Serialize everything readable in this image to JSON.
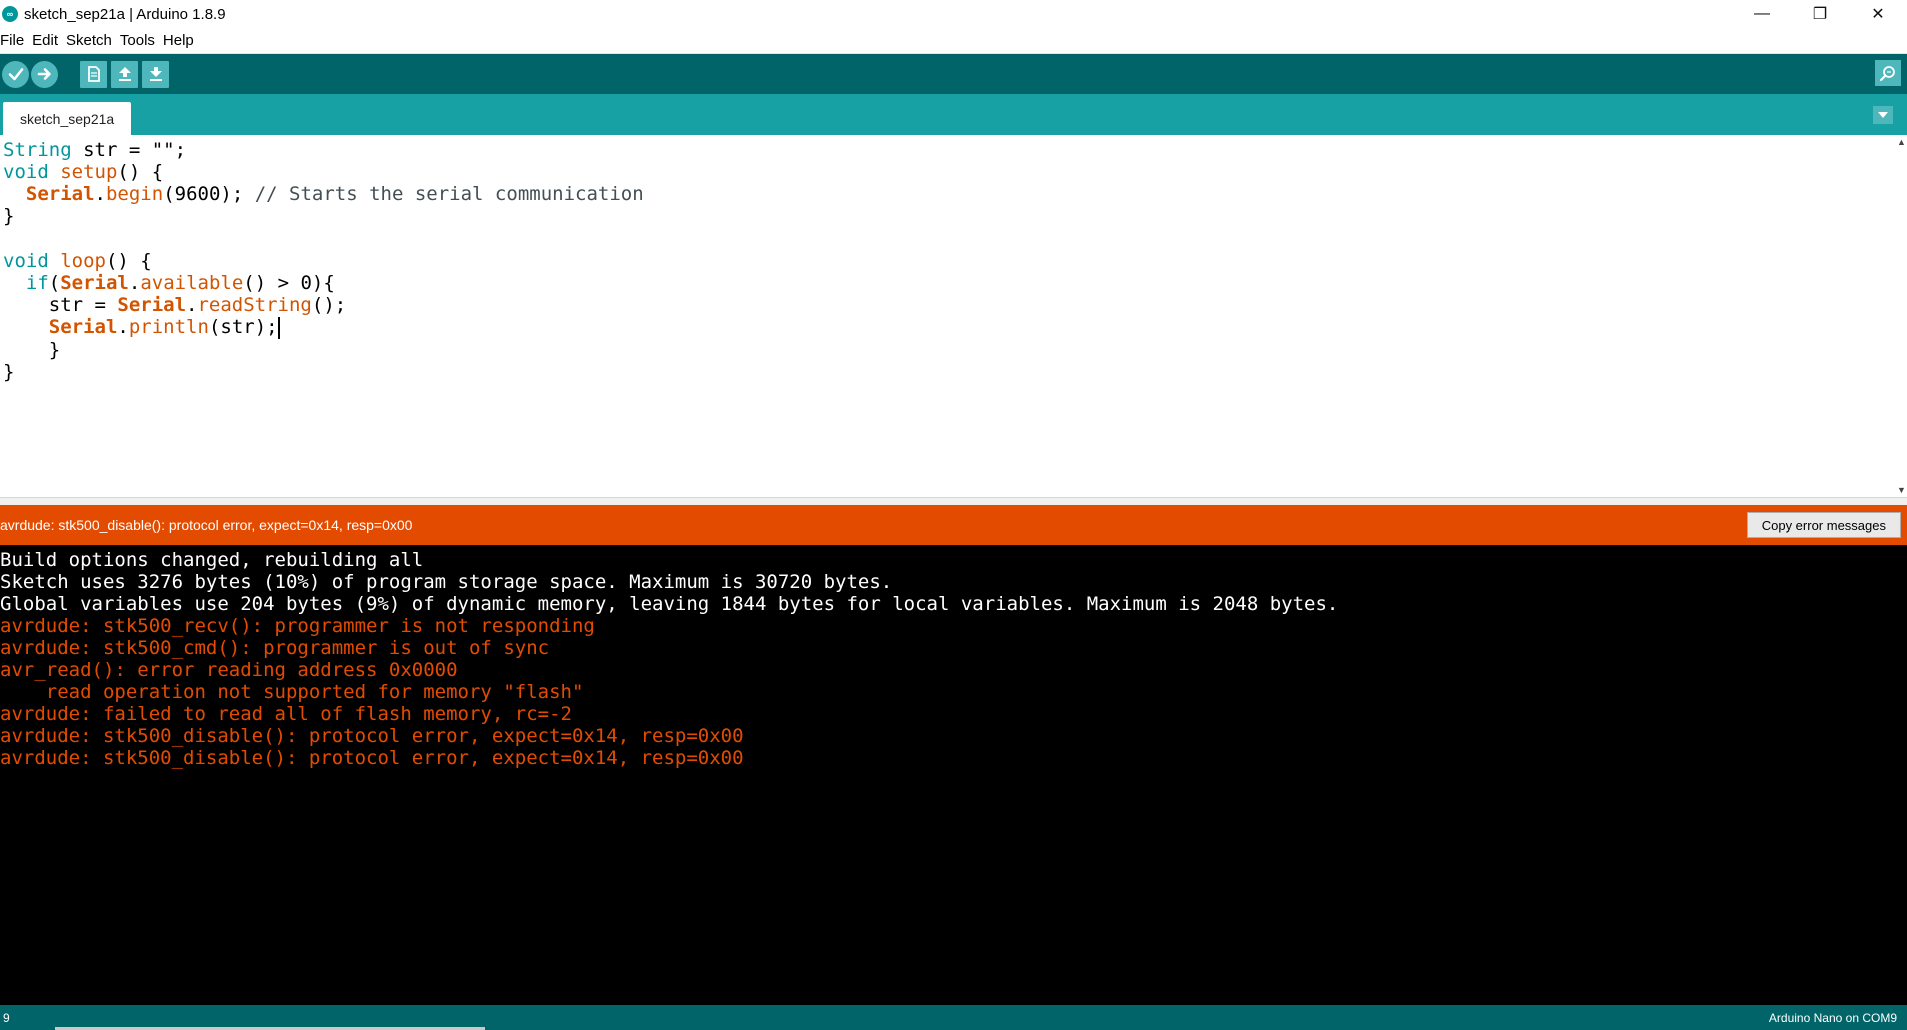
{
  "window": {
    "title": "sketch_sep21a | Arduino 1.8.9",
    "icon": "arduino-logo-icon",
    "controls": {
      "minimize": "—",
      "maximize": "❐",
      "close": "✕"
    }
  },
  "menu": {
    "items": [
      "File",
      "Edit",
      "Sketch",
      "Tools",
      "Help"
    ]
  },
  "toolbar": {
    "buttons": [
      "verify-icon",
      "upload-icon",
      "new-icon",
      "open-icon",
      "save-icon"
    ],
    "serial_monitor": "serial-monitor-icon"
  },
  "tabs": {
    "active": "sketch_sep21a",
    "menu_icon": "▼"
  },
  "editor": {
    "lines": [
      "String str = \"\";",
      "void setup() {",
      "  Serial.begin(9600); // Starts the serial communication",
      "}",
      "",
      "void loop() {",
      "  if(Serial.available() > 0){",
      "    str = Serial.readString();",
      "    Serial.println(str);",
      "    }",
      "}"
    ]
  },
  "status": {
    "message": "avrdude: stk500_disable(): protocol error, expect=0x14, resp=0x00",
    "copy_button": "Copy error messages"
  },
  "console": {
    "lines": [
      {
        "text": "Build options changed, rebuilding all",
        "type": "info"
      },
      {
        "text": "Sketch uses 3276 bytes (10%) of program storage space. Maximum is 30720 bytes.",
        "type": "info"
      },
      {
        "text": "Global variables use 204 bytes (9%) of dynamic memory, leaving 1844 bytes for local variables. Maximum is 2048 bytes.",
        "type": "info"
      },
      {
        "text": "avrdude: stk500_recv(): programmer is not responding",
        "type": "error"
      },
      {
        "text": "avrdude: stk500_cmd(): programmer is out of sync",
        "type": "error"
      },
      {
        "text": "avr_read(): error reading address 0x0000",
        "type": "error"
      },
      {
        "text": "    read operation not supported for memory \"flash\"",
        "type": "error"
      },
      {
        "text": "avrdude: failed to read all of flash memory, rc=-2",
        "type": "error"
      },
      {
        "text": "avrdude: stk500_disable(): protocol error, expect=0x14, resp=0x00",
        "type": "error"
      },
      {
        "text": "avrdude: stk500_disable(): protocol error, expect=0x14, resp=0x00",
        "type": "error"
      }
    ]
  },
  "footer": {
    "line_number": "9",
    "board": "Arduino Nano on COM9"
  },
  "colors": {
    "toolbar": "#006468",
    "tabbar": "#17a1a5",
    "error_bar": "#e34c00",
    "console_bg": "#000000",
    "keyword": "#00979c",
    "function": "#d35400"
  }
}
